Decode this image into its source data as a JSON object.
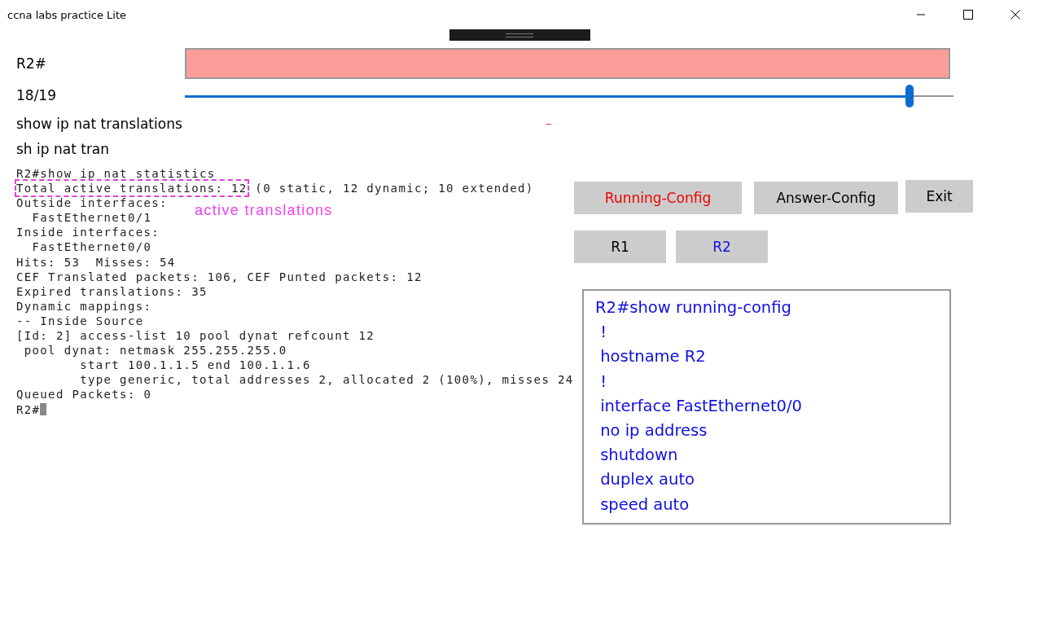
{
  "window": {
    "title": "ccna labs practice Lite"
  },
  "prompt": "R2#",
  "answer": {
    "correct": false
  },
  "progress": {
    "text": "18/19",
    "level": 0.943
  },
  "command": "show ip nat translations",
  "error_mark": "–",
  "abbreviation": "sh ip nat tran",
  "terminal": {
    "lines": [
      {
        "text": "R2#show ip nat statistics"
      },
      {
        "highlight": "Total active translations: 12",
        "text": " (0 static, 12 dynamic; 10 extended)"
      },
      {
        "text": "Outside interfaces:"
      },
      {
        "text": "  FastEthernet0/1"
      },
      {
        "text": "Inside interfaces:"
      },
      {
        "text": "  FastEthernet0/0"
      },
      {
        "text": "Hits: 53  Misses: 54"
      },
      {
        "text": "CEF Translated packets: 106, CEF Punted packets: 12"
      },
      {
        "text": "Expired translations: 35"
      },
      {
        "text": "Dynamic mappings:"
      },
      {
        "text": "-- Inside Source"
      },
      {
        "text": "[Id: 2] access-list 10 pool dynat refcount 12"
      },
      {
        "text": " pool dynat: netmask 255.255.255.0"
      },
      {
        "text": "        start 100.1.1.5 end 100.1.1.6"
      },
      {
        "text": "        type generic, total addresses 2, allocated 2 (100%), misses 24"
      },
      {
        "text": "Queued Packets: 0"
      },
      {
        "text": "R2#",
        "cursor": true
      }
    ],
    "annotation": "active translations"
  },
  "config_buttons": [
    {
      "label": "Running-Config",
      "selected": true
    },
    {
      "label": "Answer-Config",
      "selected": false
    }
  ],
  "exit_button": "Exit",
  "routers": [
    {
      "label": "R1",
      "selected": false
    },
    {
      "label": "R2",
      "selected": true
    }
  ],
  "config_output": [
    "R2#show running-config",
    " !",
    " hostname R2",
    " !",
    " interface FastEthernet0/0",
    " no ip address",
    " shutdown",
    " duplex auto",
    " speed auto"
  ]
}
